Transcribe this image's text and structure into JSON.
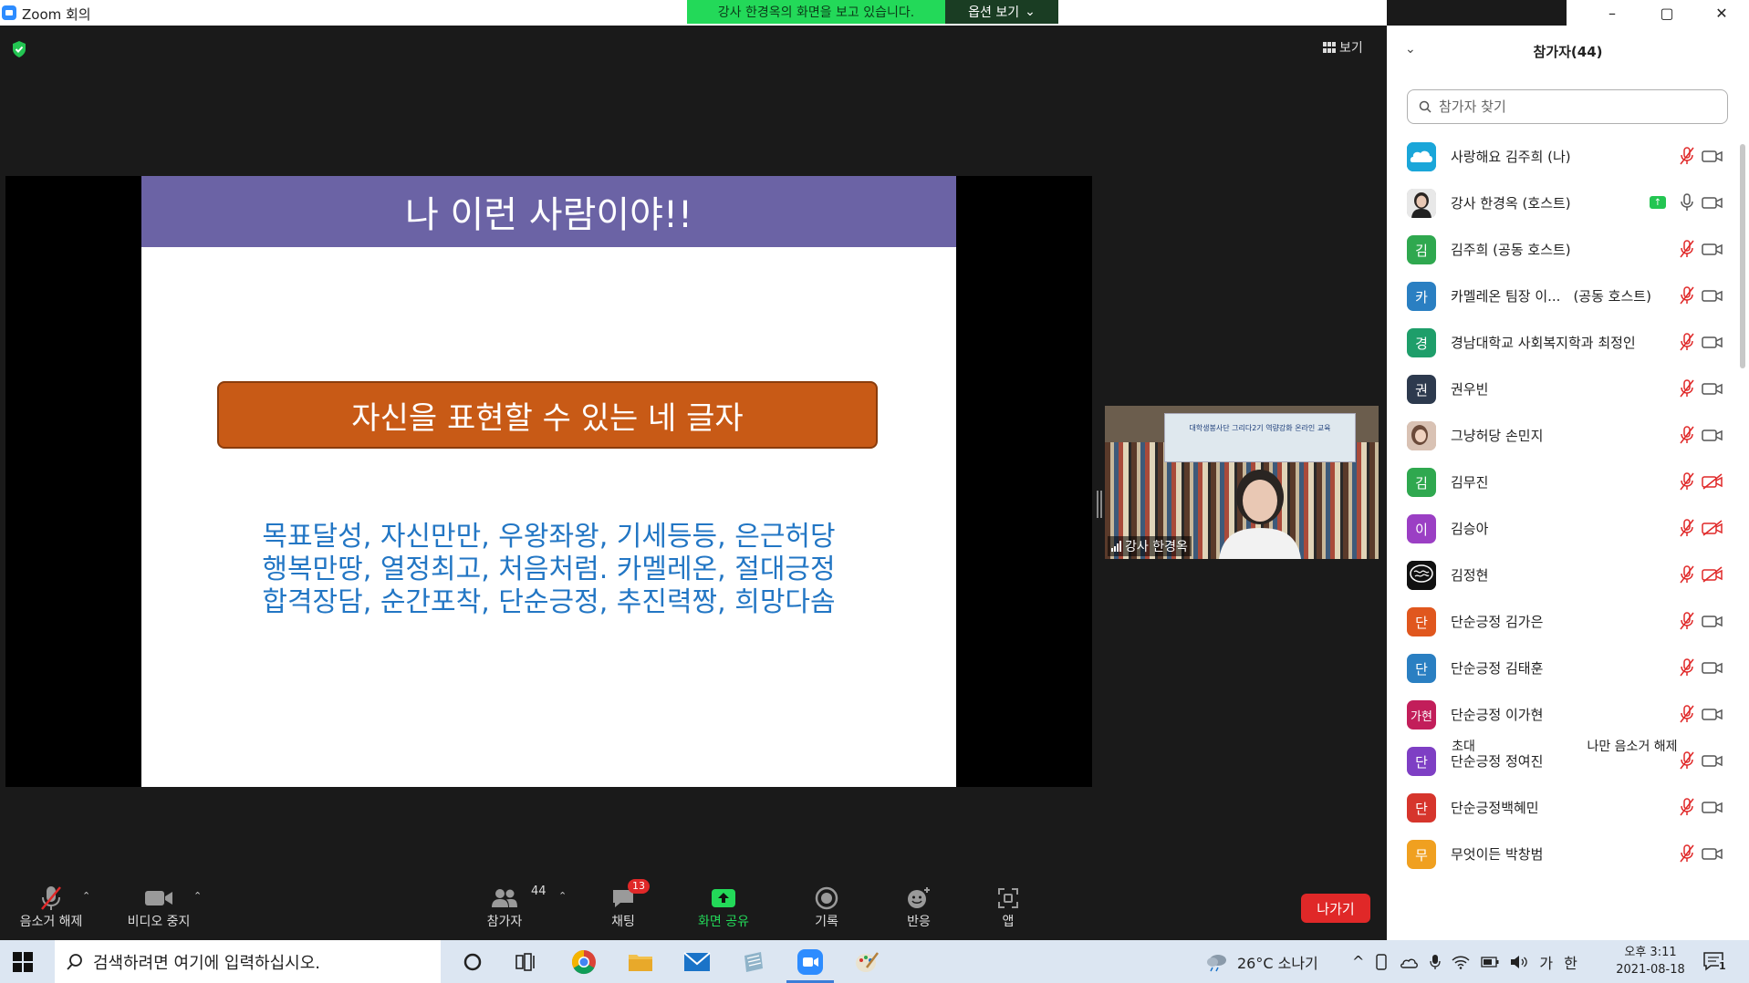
{
  "window": {
    "title": "Zoom 회의",
    "controls": [
      "–",
      "▢",
      "✕"
    ]
  },
  "share_banner": {
    "text": "강사 한경옥의 화면을 보고 있습니다.",
    "options_label": "옵션 보기"
  },
  "view_button": "보기",
  "slide": {
    "title": "나 이런 사람이야!!",
    "bar_text": "자신을 표현할 수 있는 네 글자",
    "words": [
      "목표달성, 자신만만, 우왕좌왕, 기세등등, 은근허당",
      "행복만땅, 열정최고, 처음처럼. 카멜레온, 절대긍정",
      "합격장담, 순간포착, 단순긍정, 추진력짱, 희망다솜"
    ],
    "header_color": "#6b63a5",
    "bar_color": "#c85a16",
    "word_color": "#2276c4"
  },
  "video_tile": {
    "name": "강사 한경옥",
    "poster_text": "대학생봉사단 그리다2기 역량강화 온라인 교육"
  },
  "toolbar": {
    "unmute": "음소거 해제",
    "stop_video": "비디오 중지",
    "participants": "참가자",
    "participants_count": "44",
    "chat": "채팅",
    "chat_badge": "13",
    "share_screen": "화면 공유",
    "record": "기록",
    "reactions": "반응",
    "apps": "앱",
    "leave": "나가기",
    "share_color": "#23d959",
    "leave_color": "#e02828"
  },
  "panel": {
    "title": "참가자(44)",
    "search_placeholder": "참가자 찾기",
    "invite": "초대",
    "unmute_me": "나만 음소거 해제",
    "participants": [
      {
        "name": "사랑해요 김주희 (나)",
        "avatar": "cloud",
        "color": "#1aa6d9",
        "mic": "muted",
        "cam": "on"
      },
      {
        "name": "강사 한경옥 (호스트)",
        "avatar": "photo",
        "color": "#bbbbbb",
        "mic": "on",
        "cam": "on",
        "sharing": true
      },
      {
        "name": "김주희 (공동 호스트)",
        "avatar": "김",
        "color": "#2fa84f",
        "mic": "muted",
        "cam": "on"
      },
      {
        "name": "카멜레온 팀장 이...",
        "role": "(공동 호스트)",
        "avatar": "카",
        "color": "#2a7fc2",
        "mic": "muted",
        "cam": "on"
      },
      {
        "name": "경남대학교 사회복지학과 최정인",
        "avatar": "경",
        "color": "#1e9e6a",
        "mic": "muted",
        "cam": "on"
      },
      {
        "name": "권우빈",
        "avatar": "권",
        "color": "#2d3a4e",
        "mic": "muted",
        "cam": "on"
      },
      {
        "name": "그냥허당 손민지",
        "avatar": "photo2",
        "color": "#c9a99a",
        "mic": "muted",
        "cam": "on"
      },
      {
        "name": "김무진",
        "avatar": "김",
        "color": "#2fa84f",
        "mic": "muted",
        "cam": "off"
      },
      {
        "name": "김승아",
        "avatar": "이",
        "color": "#9b3fc4",
        "mic": "muted",
        "cam": "off"
      },
      {
        "name": "김정현",
        "avatar": "brain",
        "color": "#111111",
        "mic": "muted",
        "cam": "off"
      },
      {
        "name": "단순긍정 김가은",
        "avatar": "단",
        "color": "#e0571e",
        "mic": "muted",
        "cam": "on"
      },
      {
        "name": "단순긍정 김태훈",
        "avatar": "단",
        "color": "#2a7fc2",
        "mic": "muted",
        "cam": "on"
      },
      {
        "name": "단순긍정 이가현",
        "avatar": "가현",
        "color": "#c21e5a",
        "mic": "muted",
        "cam": "on"
      },
      {
        "name": "단순긍정 정여진",
        "avatar": "단",
        "color": "#7e3fc4",
        "mic": "muted",
        "cam": "on"
      },
      {
        "name": "단순긍정백혜민",
        "avatar": "단",
        "color": "#d6352c",
        "mic": "muted",
        "cam": "on"
      },
      {
        "name": "무엇이든 박창범",
        "avatar": "무",
        "color": "#f0a020",
        "mic": "muted",
        "cam": "on"
      }
    ]
  },
  "taskbar": {
    "search_placeholder": "검색하려면 여기에 입력하십시오.",
    "weather": "26°C 소나기",
    "ime_ga": "가",
    "ime_han": "한",
    "time": "오후 3:11",
    "date": "2021-08-18",
    "notification_count": "1"
  }
}
